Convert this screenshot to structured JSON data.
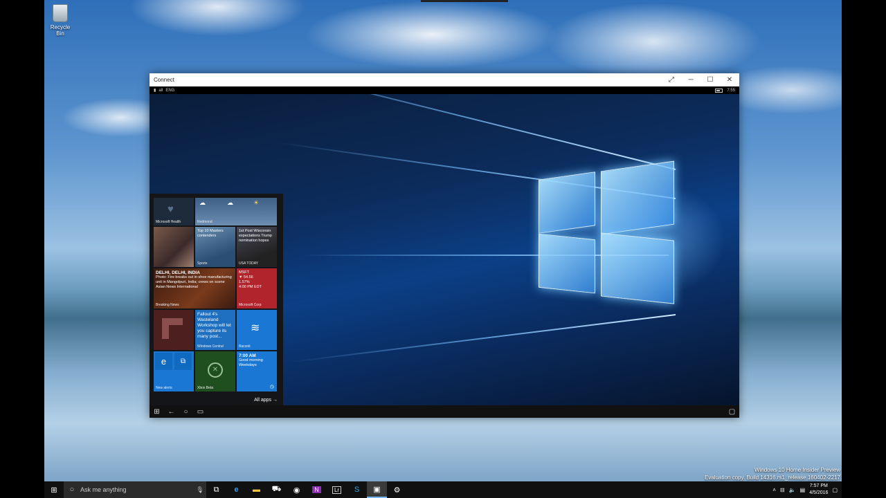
{
  "desktop": {
    "recycle_bin_label": "Recycle Bin",
    "watermark_line1": "Windows 10 Home Insider Preview",
    "watermark_line2": "Evaluation copy. Build 14316.rs1_release.160402-2217"
  },
  "window": {
    "title": "Connect",
    "phone_status": {
      "signal": "all",
      "network": "ENG",
      "time": "7:55"
    }
  },
  "start_menu": {
    "tiles": {
      "health_label": "Microsoft Health",
      "weather_label": "Redmond",
      "sports_text": "Top 10 Masters contenders",
      "sports_label": "Sports",
      "news_text": "1st Post Wisconsin expectations Trump nomination hopes",
      "news_label": "USA TODAY",
      "breaking_title": "DELHI, DELHI, INDIA",
      "breaking_text": "Photo: Fire breaks out in shoe manufacturing unit in Mangolpuri, India; crews on scene Asian News International",
      "breaking_label": "Breaking News",
      "stock_symbol": "MSFT",
      "stock_change": "▼ 54.56",
      "stock_pct": "1.57%",
      "stock_time": "4:00 PM EDT",
      "stock_label": "Microsoft Corp",
      "wc_text": "Fallout 4's Wasteland Workshop will let you capture its many post...",
      "wc_label": "Windows Central",
      "baconit_label": "Baconit",
      "edge_label": "New alerts",
      "xbox_label": "Xbox Beta",
      "alarm_time": "7:00 AM",
      "alarm_text": "Good morning Weekdays"
    },
    "all_apps": "All apps"
  },
  "taskbar": {
    "search_placeholder": "Ask me anything",
    "clock_time": "7:57 PM",
    "clock_date": "4/5/2016"
  }
}
